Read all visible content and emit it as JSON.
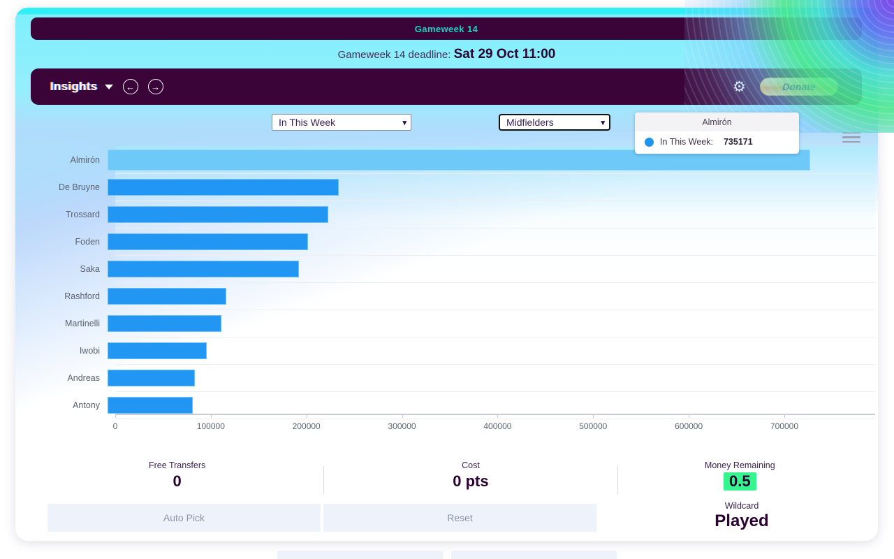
{
  "header": {
    "gameweek_title": "Gameweek 14",
    "deadline_label": "Gameweek 14 deadline:",
    "deadline_value": "Sat 29 Oct 11:00",
    "accent_teal": "#15d6c0",
    "bar_purple": "#3a0438"
  },
  "nav": {
    "title": "Insights",
    "caret": "▾",
    "prev_icon": "←",
    "next_icon": "→",
    "gear_icon": "⚙",
    "donate_label": "Donate"
  },
  "controls": {
    "metric_select": {
      "value": "In This Week",
      "caret": "❯"
    },
    "position_select": {
      "value": "Midfielders",
      "caret": "❯"
    },
    "menu_icon": "hamburger-menu"
  },
  "tooltip": {
    "title": "Almirón",
    "series_label": "In This Week:",
    "value": "735171",
    "dot_color": "#1e94ef"
  },
  "chart_data": {
    "type": "bar",
    "orientation": "horizontal",
    "title": "",
    "xlabel": "",
    "ylabel": "",
    "series_name": "In This Week",
    "bar_color": "#2196f3",
    "highlight_color": "#6ec8f8",
    "categories": [
      "Almirón",
      "De Bruyne",
      "Trossard",
      "Foden",
      "Saka",
      "Rashford",
      "Martinelli",
      "Iwobi",
      "Andreas",
      "Antony"
    ],
    "values": [
      735171,
      242000,
      231000,
      210000,
      200000,
      124000,
      119000,
      104000,
      91000,
      89000
    ],
    "highlighted_index": 0,
    "xlim": [
      0,
      795000
    ],
    "xticks": [
      0,
      100000,
      200000,
      300000,
      400000,
      500000,
      600000,
      700000
    ],
    "xtick_labels": [
      "0",
      "100000",
      "200000",
      "300000",
      "400000",
      "500000",
      "600000",
      "700000"
    ],
    "grid": true,
    "legend": "none"
  },
  "stats": [
    {
      "label": "Free Transfers",
      "value": "0",
      "highlight": false
    },
    {
      "label": "Cost",
      "value": "0 pts",
      "highlight": false
    },
    {
      "label": "Money Remaining",
      "value": "0.5",
      "highlight": true,
      "highlight_color": "#34f58e"
    }
  ],
  "actions": {
    "auto_pick_label": "Auto Pick",
    "reset_label": "Reset"
  },
  "wildcard": {
    "label": "Wildcard",
    "value": "Played"
  }
}
